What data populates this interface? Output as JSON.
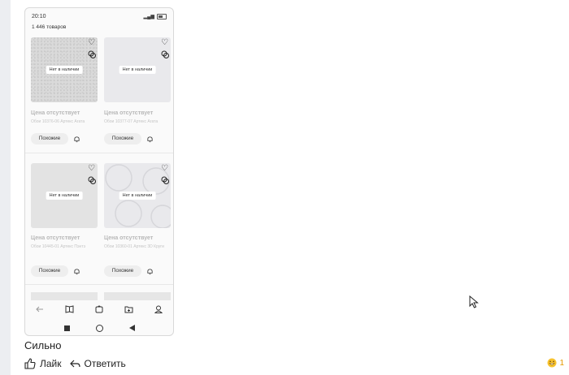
{
  "phone": {
    "status_time": "20:10",
    "result_count": "1 446 товаров",
    "cards": [
      {
        "badge": "Нет в наличии",
        "price": "Цена отсутствует",
        "desc": "Обои 10376-06 Артекс Агата",
        "similar_label": "Похожие"
      },
      {
        "badge": "Нет в наличии",
        "price": "Цена отсутствует",
        "desc": "Обои 10377-07 Артекс Агата",
        "similar_label": "Похожие"
      },
      {
        "badge": "Нет в наличии",
        "price": "Цена отсутствует",
        "desc": "Обои 10445-01 Артекс Пэнтэ",
        "similar_label": "Похожие"
      },
      {
        "badge": "Нет в наличии",
        "price": "Цена отсутствует",
        "desc": "Обои 10360-01 Артекс 3D Круги",
        "similar_label": "Похожие"
      }
    ],
    "bottom_tabs": [
      "back-icon",
      "catalog-icon",
      "home-icon",
      "cart-icon",
      "profile-icon"
    ],
    "system_nav": [
      "square-icon",
      "circle-icon",
      "back-triangle-icon"
    ]
  },
  "comment": {
    "text": "Сильно",
    "like_label": "Лайк",
    "reply_label": "Ответить",
    "reaction_count": "1"
  }
}
